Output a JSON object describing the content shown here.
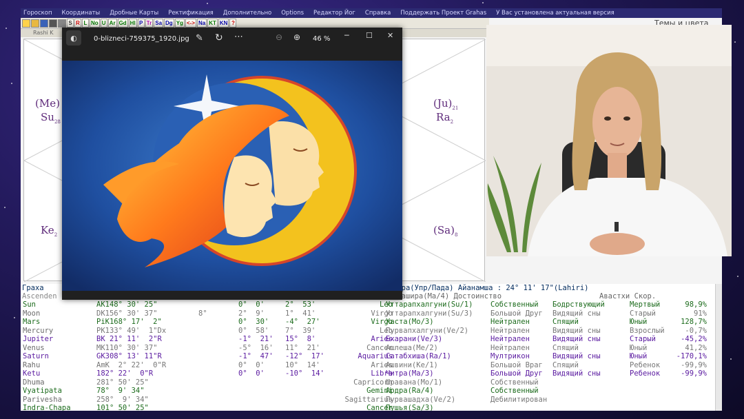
{
  "menu": [
    "Гороскоп",
    "Координаты",
    "Дробные Карты",
    "Ректификация",
    "Дополнительно",
    "Options",
    "Редактор Йог",
    "Справка",
    "Поддержать Проект Grahas",
    "У Вас установлена актуальная версия"
  ],
  "right_hint": "Темы и цвета",
  "toolbar_buttons": [
    "S",
    "R",
    "L",
    "No",
    "U",
    "Ar",
    "Gd",
    "Hl",
    "P",
    "Tr",
    "Sa",
    "Dg",
    "Yg",
    "<->",
    "Na",
    "KT",
    "KN",
    "?"
  ],
  "tab_label": "Rashi K",
  "chart_planets": {
    "me": "(Me)",
    "su": "Su",
    "su_deg": "28",
    "ju": "(Ju)",
    "ju_deg": "21",
    "ra": "Ra",
    "ra_deg": "2",
    "ke": "Ke",
    "ke_deg": "2",
    "sa": "(Sa)",
    "sa_deg": "8"
  },
  "viewer": {
    "filename": "0-blizneci-759375_1920.jpg",
    "zoom": "46 %",
    "min": "─",
    "max": "☐",
    "close": "✕"
  },
  "table": {
    "header_left": "Граха",
    "header_right": "итра(Упр/Пада)  Айанамша : 24° 11' 17\"(Lahiri)",
    "header2_left": "Ascenden",
    "header2_mid": "игашира(Ма/4)  Достоинство",
    "header2_right": "Авастхи  Скор.",
    "rows": [
      {
        "n": "Sun",
        "k": "AK148° 30' 25\"",
        "p": "",
        "a": "0°  0'",
        "b": "2°  53'",
        "s": "Leo",
        "nk": "Уттарапхалгуни(Su/1)",
        "d": "Собственный",
        "av": "Бодрствующий",
        "ag": "Мертвый",
        "sc": "98,9%",
        "cls": "g"
      },
      {
        "n": "Moon",
        "k": "DK156° 30' 37\"",
        "p": "8°",
        "a": "2°  9'",
        "b": "1°  41'",
        "s": "Virgo",
        "nk": "Уттарапхалгуни(Su/3)",
        "d": "Большой Друг",
        "av": "Видящий сны",
        "ag": "Старый",
        "sc": "91%",
        "cls": ""
      },
      {
        "n": "Mars",
        "k": "PiK168° 17'  2\"",
        "p": "",
        "a": "0°  30'",
        "b": "-4°  27'",
        "s": "Virgo",
        "nk": "Хаста(Mo/3)",
        "d": "Нейтрален",
        "av": "Спящий",
        "ag": "Юный",
        "sc": "128,7%",
        "cls": "g"
      },
      {
        "n": "Mercury",
        "k": "PK133° 49'  1\"Dx",
        "p": "",
        "a": "0°  58'",
        "b": "7°  39'",
        "s": "Leo",
        "nk": "Пурвапхалгуни(Ve/2)",
        "d": "Нейтрален",
        "av": "Видящий сны",
        "ag": "Взрослый",
        "sc": "-0,7%",
        "cls": ""
      },
      {
        "n": "Jupiter",
        "k": "BK 21° 11'  2\"R",
        "p": "",
        "a": "-1°  21'",
        "b": "15°  8'",
        "s": "Aries",
        "nk": "Бхарани(Ve/3)",
        "d": "Нейтрален",
        "av": "Видящий сны",
        "ag": "Старый",
        "sc": "-45,2%",
        "cls": "b"
      },
      {
        "n": "Venus",
        "k": "MK110° 30' 37\"",
        "p": "",
        "a": "-5°  16'",
        "b": "11°  21'",
        "s": "Cancer",
        "nk": "Ашлеша(Me/2)",
        "d": "Нейтрален",
        "av": "Спящий",
        "ag": "Юный",
        "sc": "41,2%",
        "cls": ""
      },
      {
        "n": "Saturn",
        "k": "GK308° 13' 11\"R",
        "p": "",
        "a": "-1°  47'",
        "b": "-12°  17'",
        "s": "Aquarius",
        "nk": "Сатабхиша(Ra/1)",
        "d": "Мултрикон",
        "av": "Видящий сны",
        "ag": "Юный",
        "sc": "-170,1%",
        "cls": "b"
      },
      {
        "n": "Rahu",
        "k": "AmK  2° 22'  0\"R",
        "p": "",
        "a": "0°  0'",
        "b": "10°  14'",
        "s": "Aries",
        "nk": "Ашвини(Ke/1)",
        "d": "Большой Враг",
        "av": "Спящий",
        "ag": "Ребенок",
        "sc": "-99,9%",
        "cls": ""
      },
      {
        "n": "Ketu",
        "k": "182° 22'  0\"R",
        "p": "",
        "a": "0°  0'",
        "b": "-10°  14'",
        "s": "Libra",
        "nk": "Читра(Ma/3)",
        "d": "Большой Друг",
        "av": "Видящий сны",
        "ag": "Ребенок",
        "sc": "-99,9%",
        "cls": "b"
      },
      {
        "n": "Dhuma",
        "k": "281° 50' 25\"",
        "p": "",
        "a": "",
        "b": "",
        "s": "Capricorn",
        "nk": "Шравана(Mo/1)",
        "d": "Собственный",
        "av": "",
        "ag": "",
        "sc": "",
        "cls": ""
      },
      {
        "n": "Vyatipata",
        "k": "78°  9' 34\"",
        "p": "",
        "a": "",
        "b": "",
        "s": "Gemini",
        "nk": "Ардра(Ra/4)",
        "d": "Собственный",
        "av": "",
        "ag": "",
        "sc": "",
        "cls": "g"
      },
      {
        "n": "Parivesha",
        "k": "258°  9' 34\"",
        "p": "",
        "a": "",
        "b": "",
        "s": "Sagittarius",
        "nk": "Пурвашадха(Ve/2)",
        "d": "Дебилитирован",
        "av": "",
        "ag": "",
        "sc": "",
        "cls": ""
      },
      {
        "n": "Indra-Chapa",
        "k": "101° 50' 25\"",
        "p": "",
        "a": "",
        "b": "",
        "s": "Cancer",
        "nk": "Пушья(Sa/3)",
        "d": "",
        "av": "",
        "ag": "",
        "sc": "",
        "cls": "g"
      }
    ]
  }
}
